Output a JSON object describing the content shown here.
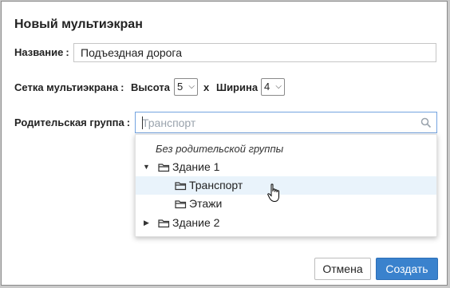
{
  "dialog": {
    "title": "Новый мультиэкран",
    "name_label": "Название",
    "name_value": "Подъездная дорога",
    "grid_label": "Сетка мультиэкрана",
    "height_label": "Высота",
    "height_value": "5",
    "x_label": "x",
    "width_label": "Ширина",
    "width_value": "4",
    "parent_label": "Родительская группа",
    "parent_placeholder": "Транспорт",
    "colon": ":"
  },
  "dropdown": {
    "no_parent": "Без родительской группы",
    "items": [
      {
        "label": "Здание 1",
        "expanded": true
      },
      {
        "label": "Транспорт",
        "selected": true
      },
      {
        "label": "Этажи"
      },
      {
        "label": "Здание 2",
        "expanded": false
      }
    ]
  },
  "buttons": {
    "cancel": "Отмена",
    "create": "Создать"
  },
  "colors": {
    "primary": "#3a82cd",
    "hover_row": "#e9f3fb",
    "focus_border": "#74a4e0"
  }
}
